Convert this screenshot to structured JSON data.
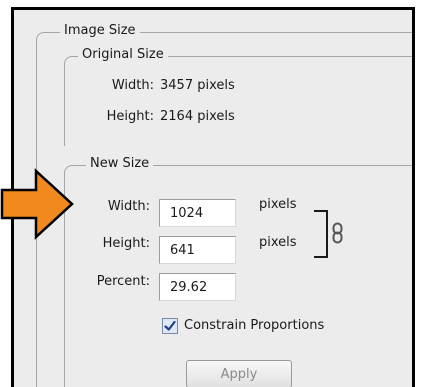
{
  "image_size": {
    "legend": "Image Size",
    "original": {
      "legend": "Original Size",
      "width_label": "Width:",
      "width_value": "3457 pixels",
      "height_label": "Height:",
      "height_value": "2164 pixels"
    },
    "new": {
      "legend": "New Size",
      "width_label": "Width:",
      "width_value": "1024",
      "width_unit": "pixels",
      "height_label": "Height:",
      "height_value": "641",
      "height_unit": "pixels",
      "percent_label": "Percent:",
      "percent_value": "29.62",
      "constrain_label": "Constrain Proportions",
      "constrain_checked": true
    },
    "apply_label": "Apply"
  },
  "icons": {
    "chain": "chain-link-icon",
    "check": "checkmark-icon",
    "arrow": "arrow-right-icon"
  },
  "colors": {
    "arrow_fill": "#f08a1e",
    "check": "#1f3f8f"
  }
}
